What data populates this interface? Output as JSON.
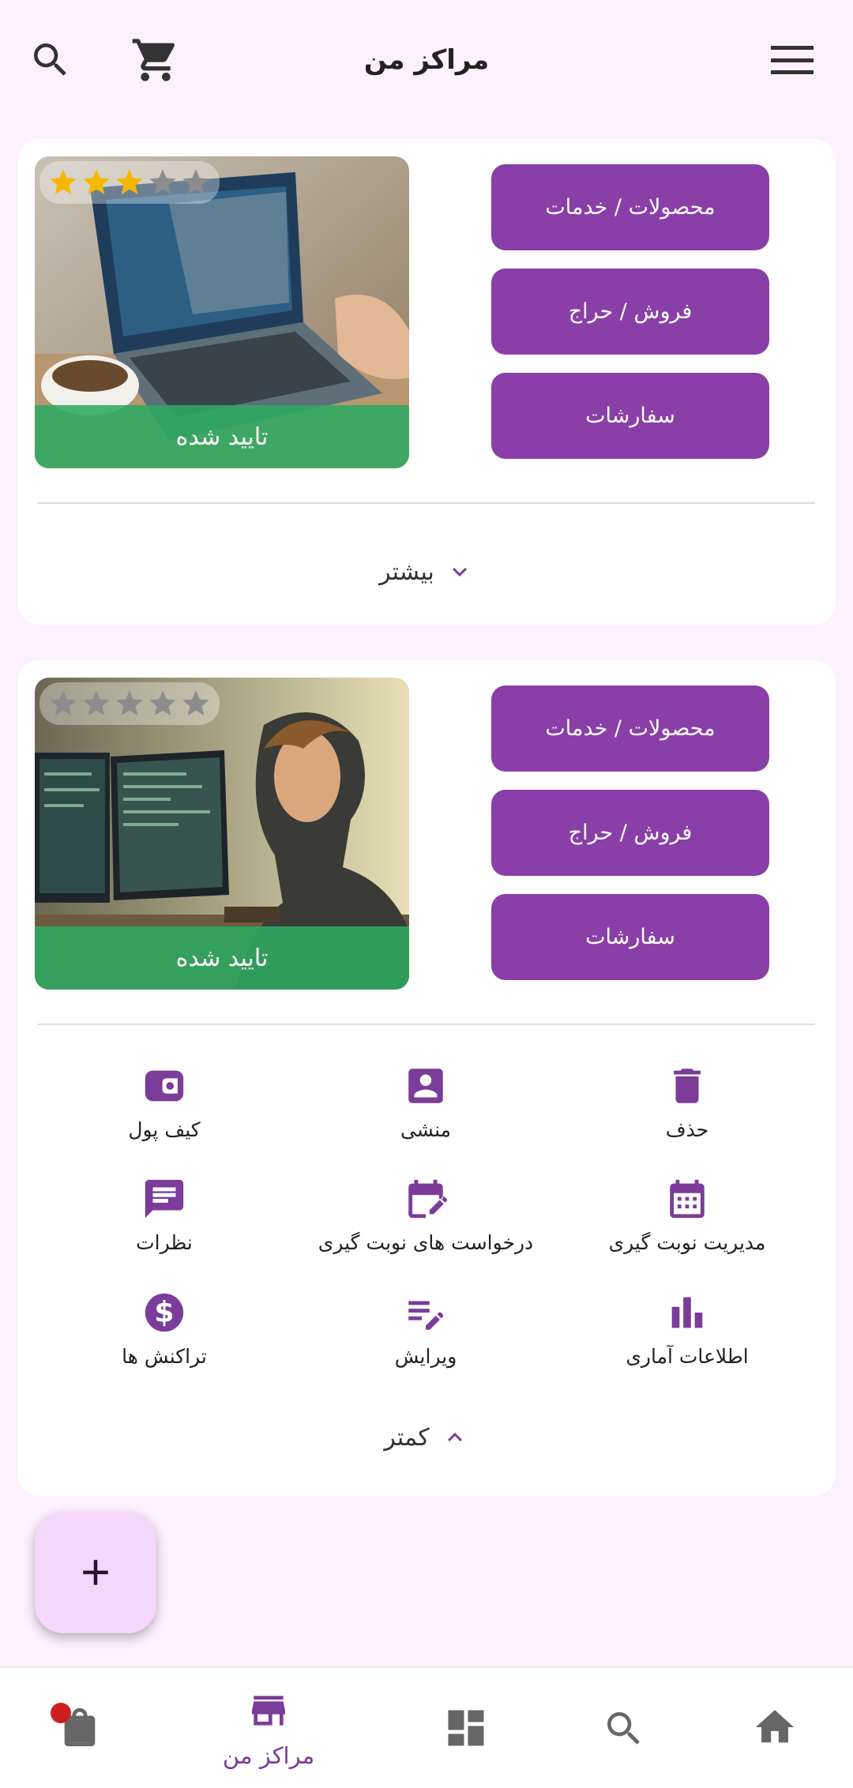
{
  "header": {
    "title": "مراکز من",
    "search_icon": "search-icon",
    "cart_icon": "shopping-cart-icon",
    "menu_icon": "hamburger-menu-icon"
  },
  "colors": {
    "accent": "#8a3fa8",
    "background": "#fcf1fc",
    "status_green": "#2eaa62",
    "star_filled": "#f5b800",
    "star_empty": "#8c8c8c"
  },
  "centers": [
    {
      "rating": 3,
      "rating_max": 5,
      "status": "تایید شده",
      "buttons": [
        "محصولات / خدمات",
        "فروش / حراج",
        "سفارشات"
      ],
      "expanded": false,
      "toggle_label": "بیشتر"
    },
    {
      "rating": 0,
      "rating_max": 5,
      "status": "تایید شده",
      "buttons": [
        "محصولات / خدمات",
        "فروش / حراج",
        "سفارشات"
      ],
      "expanded": true,
      "toggle_label": "کمتر",
      "actions": [
        {
          "label": "حذف",
          "icon": "trash-icon"
        },
        {
          "label": "منشی",
          "icon": "secretary-icon"
        },
        {
          "label": "کیف پول",
          "icon": "wallet-icon"
        },
        {
          "label": "مدیریت نوبت گیری",
          "icon": "calendar-grid-icon"
        },
        {
          "label": "درخواست های نوبت گیری",
          "icon": "calendar-edit-icon"
        },
        {
          "label": "نظرات",
          "icon": "comment-icon"
        },
        {
          "label": "اطلاعات آماری",
          "icon": "bar-chart-icon"
        },
        {
          "label": "ویرایش",
          "icon": "edit-list-icon"
        },
        {
          "label": "تراکنش ها",
          "icon": "dollar-icon"
        }
      ]
    }
  ],
  "fab": {
    "icon": "plus-icon"
  },
  "bottom_nav": {
    "items": [
      {
        "icon": "shopping-bag-icon",
        "label": "",
        "badge": true
      },
      {
        "icon": "store-icon",
        "label": "مراکز من",
        "active": true
      },
      {
        "icon": "dashboard-icon",
        "label": ""
      },
      {
        "icon": "search-icon",
        "label": ""
      },
      {
        "icon": "home-icon",
        "label": ""
      }
    ]
  }
}
